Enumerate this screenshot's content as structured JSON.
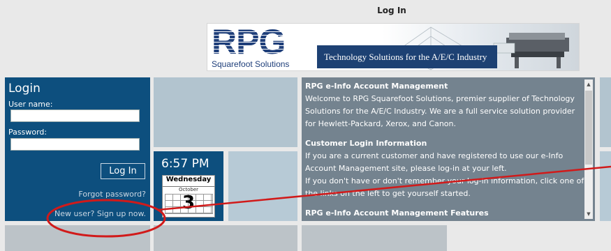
{
  "page": {
    "title": "Log In"
  },
  "banner": {
    "logo_text": "RPG",
    "logo_subtitle": "Squarefoot Solutions",
    "tagline": "Technology Solutions for the A/E/C Industry"
  },
  "login": {
    "heading": "Login",
    "username_label": "User name:",
    "password_label": "Password:",
    "username_value": "",
    "password_value": "",
    "button_label": "Log In",
    "forgot_link": "Forgot password?",
    "signup_link": "New user? Sign up now."
  },
  "clock": {
    "time": "6:57 PM",
    "weekday": "Wednesday",
    "month": "October",
    "day": "3"
  },
  "info": {
    "section1_heading": "RPG e-Info Account Management",
    "section1_text": "Welcome to RPG Squarefoot Solutions, premier supplier of Technology Solutions for the A/E/C Industry. We are a full service solution provider for Hewlett-Packard, Xerox, and Canon.",
    "section2_heading": "Customer Login Information",
    "section2_text1": "If you are a current customer and have registered to use our e-Info Account Management site, please log-in at your left.",
    "section2_text2": "If you don't have or don't remember your log-in information, click one of the links on the left to get yourself started.",
    "section3_heading": "RPG e-Info Account Management Features"
  },
  "colors": {
    "tile_blue": "#0d4f7e",
    "tile_gray": "#74838f",
    "tile_light": "#b2c4cf",
    "annotation_red": "#d11a1a"
  }
}
